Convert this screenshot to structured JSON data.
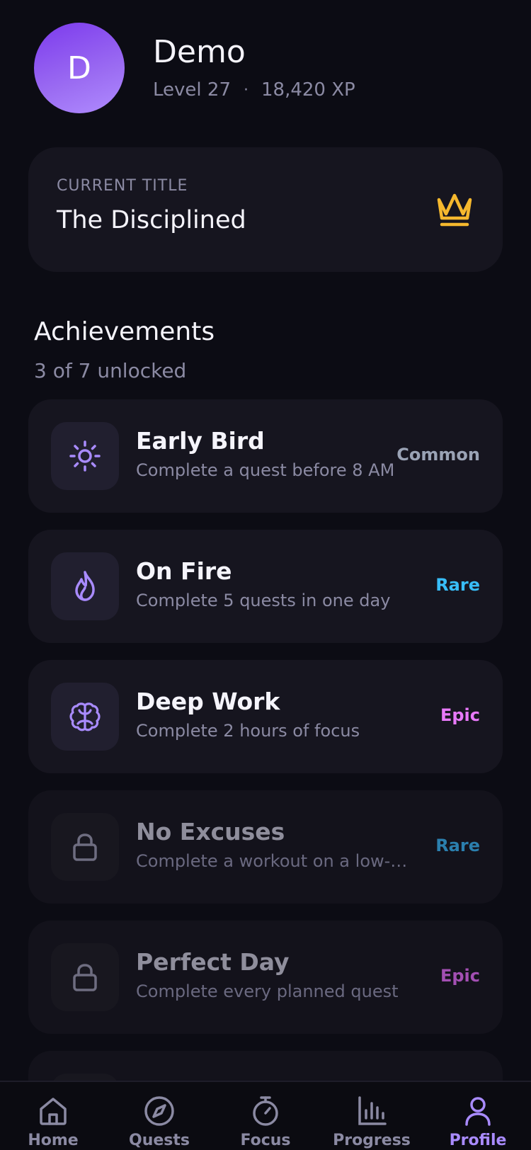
{
  "profile": {
    "avatar_letter": "D",
    "name": "Demo",
    "level": "Level 27",
    "separator": "·",
    "xp": "18,420 XP"
  },
  "current_title": {
    "label": "CURRENT TITLE",
    "value": "The Disciplined",
    "icon": "crown-icon",
    "icon_color": "#f5b82e"
  },
  "achievements": {
    "heading": "Achievements",
    "summary": "3 of 7 unlocked",
    "items": [
      {
        "name": "Early Bird",
        "desc": "Complete a quest before 8 AM",
        "rarity": "Common",
        "rarity_color": "#9aa3b5",
        "icon": "sun-icon",
        "locked": false
      },
      {
        "name": "On Fire",
        "desc": "Complete 5 quests in one day",
        "rarity": "Rare",
        "rarity_color": "#38bdf8",
        "icon": "flame-icon",
        "locked": false
      },
      {
        "name": "Deep Work",
        "desc": "Complete 2 hours of focus",
        "rarity": "Epic",
        "rarity_color": "#e879f9",
        "icon": "brain-icon",
        "locked": false
      },
      {
        "name": "No Excuses",
        "desc": "Complete a workout on a low-mo…",
        "rarity": "Rare",
        "rarity_color": "#2b7fae",
        "icon": "lock-icon",
        "locked": true
      },
      {
        "name": "Perfect Day",
        "desc": "Complete every planned quest",
        "rarity": "Epic",
        "rarity_color": "#a34fb3",
        "icon": "lock-icon",
        "locked": true
      }
    ]
  },
  "nav": {
    "items": [
      {
        "label": "Home",
        "icon": "home-icon"
      },
      {
        "label": "Quests",
        "icon": "compass-icon"
      },
      {
        "label": "Focus",
        "icon": "timer-icon"
      },
      {
        "label": "Progress",
        "icon": "bar-chart-icon"
      },
      {
        "label": "Profile",
        "icon": "user-icon"
      }
    ],
    "active": "Profile",
    "accent_color": "#a98bff"
  }
}
